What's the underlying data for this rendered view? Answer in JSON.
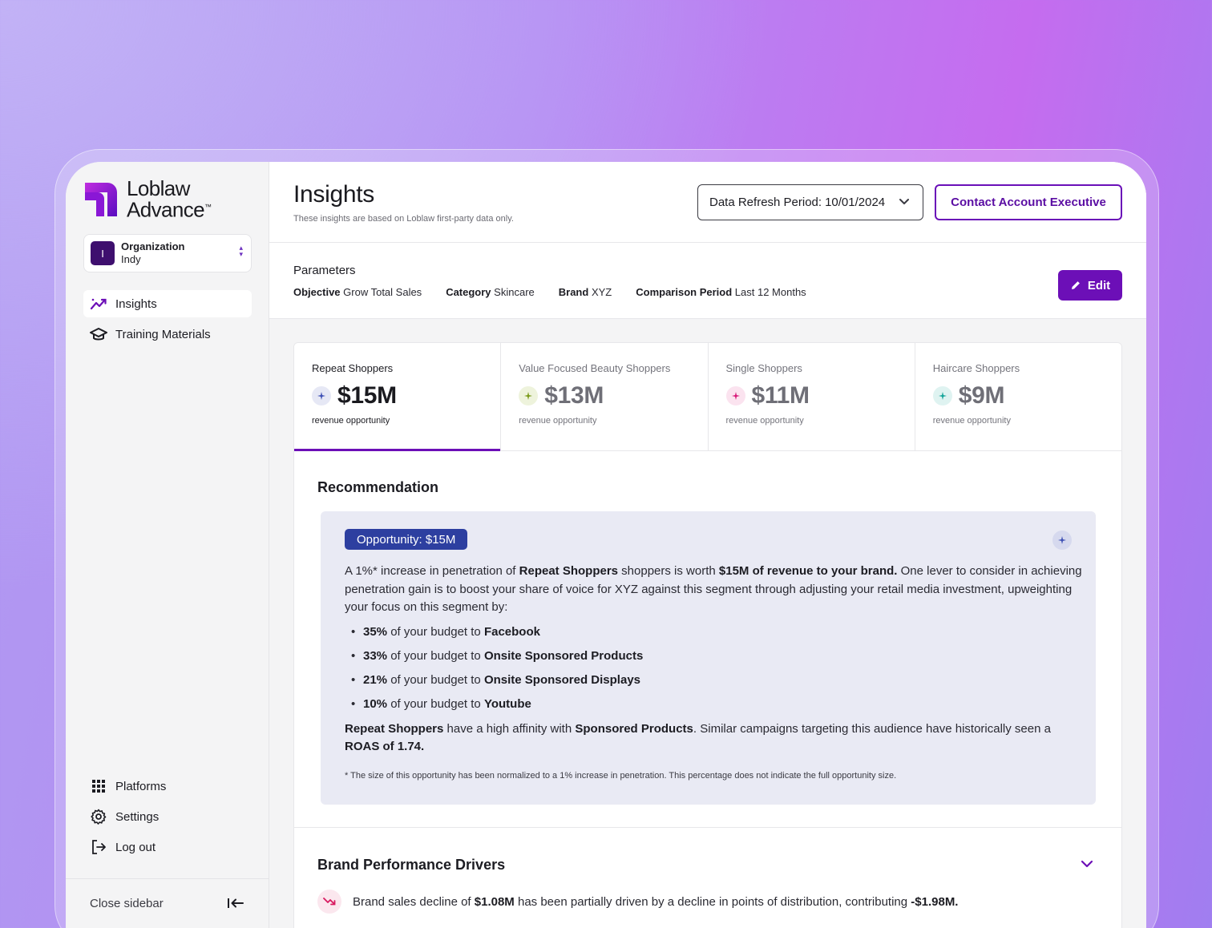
{
  "brand": {
    "line1": "Loblaw",
    "line2": "Advance",
    "trademark": "™"
  },
  "organization": {
    "label": "Organization",
    "value": "Indy",
    "avatar_letter": "I"
  },
  "nav": {
    "top": [
      {
        "label": "Insights",
        "icon": "trending-up-icon",
        "active": true
      },
      {
        "label": "Training Materials",
        "icon": "graduation-cap-icon",
        "active": false
      }
    ],
    "bottom": [
      {
        "label": "Platforms",
        "icon": "grid-icon"
      },
      {
        "label": "Settings",
        "icon": "gear-icon"
      },
      {
        "label": "Log out",
        "icon": "logout-icon"
      }
    ],
    "close_sidebar": "Close sidebar"
  },
  "header": {
    "title": "Insights",
    "subtitle": "These insights are based on Loblaw first-party data only.",
    "refresh_label": "Data Refresh Period:",
    "refresh_value": "10/01/2024",
    "contact_button": "Contact Account Executive"
  },
  "parameters": {
    "title": "Parameters",
    "items": [
      {
        "key": "Objective",
        "value": "Grow Total Sales"
      },
      {
        "key": "Category",
        "value": "Skincare"
      },
      {
        "key": "Brand",
        "value": "XYZ"
      },
      {
        "key": "Comparison Period",
        "value": "Last 12 Months"
      }
    ],
    "edit_button": "Edit"
  },
  "segments": [
    {
      "name": "Repeat Shoppers",
      "value": "$15M",
      "sub": "revenue opportunity",
      "active": true,
      "color": "#3f51b5",
      "bg": "#e6e8f5"
    },
    {
      "name": "Value Focused Beauty Shoppers",
      "value": "$13M",
      "sub": "revenue opportunity",
      "active": false,
      "color": "#7a9a1a",
      "bg": "#eef3dc"
    },
    {
      "name": "Single Shoppers",
      "value": "$11M",
      "sub": "revenue opportunity",
      "active": false,
      "color": "#d81b7a",
      "bg": "#fbe3ef"
    },
    {
      "name": "Haircare Shoppers",
      "value": "$9M",
      "sub": "revenue opportunity",
      "active": false,
      "color": "#17a59a",
      "bg": "#dff3f1"
    }
  ],
  "recommendation": {
    "title": "Recommendation",
    "badge": "Opportunity: $15M",
    "intro": {
      "t1": "A 1%* increase in penetration of ",
      "b1": "Repeat Shoppers",
      "t2": " shoppers is worth ",
      "b2": "$15M of revenue to your brand.",
      "t3": " One lever to consider in achieving penetration gain is to boost your share of voice for XYZ against this segment through adjusting your retail media investment, upweighting your focus on this segment by:"
    },
    "bullets": [
      {
        "pct": "35%",
        "mid": " of your budget to ",
        "channel": "Facebook"
      },
      {
        "pct": "33%",
        "mid": " of your budget to ",
        "channel": "Onsite Sponsored Products"
      },
      {
        "pct": "21%",
        "mid": " of your budget to ",
        "channel": "Onsite Sponsored Displays"
      },
      {
        "pct": "10%",
        "mid": " of your budget to ",
        "channel": "Youtube"
      }
    ],
    "affinity": {
      "b1": "Repeat Shoppers",
      "t1": " have a high affinity with ",
      "b2": "Sponsored Products",
      "t2": ". Similar campaigns targeting this audience have historically seen a ",
      "b3": "ROAS of 1.74."
    },
    "footnote": "* The size of this opportunity has been normalized to a 1% increase in penetration. This percentage does not indicate the full opportunity size."
  },
  "drivers": {
    "title": "Brand Performance Drivers",
    "items": [
      {
        "t1": "Brand sales decline of ",
        "b1": "$1.08M",
        "t2": " has been partially driven by a decline in points of distribution, contributing ",
        "b2": "-$1.98M."
      }
    ]
  },
  "colors": {
    "accent": "#6c0fb7",
    "badge_blue": "#2d3fa0",
    "rec_bg": "#e9eaf4"
  }
}
